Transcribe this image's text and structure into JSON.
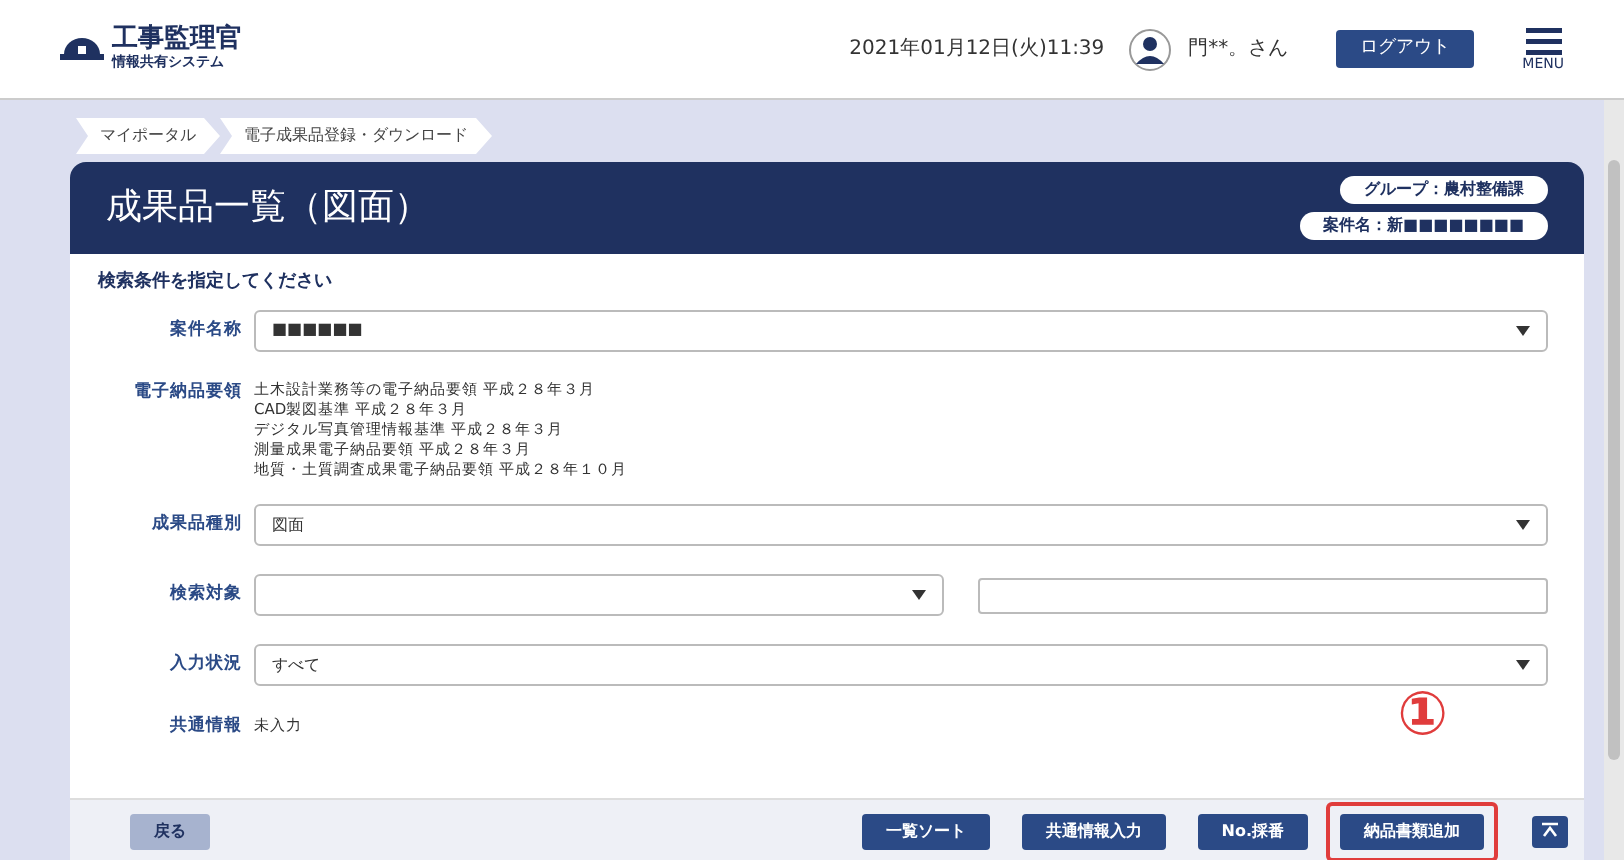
{
  "header": {
    "logo_title": "工事監理官",
    "logo_subtitle": "情報共有システム",
    "datetime": "2021年01月12日(火)11:39",
    "user_name": "門**。さん",
    "logout": "ログアウト",
    "menu_label": "MENU"
  },
  "breadcrumb": [
    {
      "label": "マイポータル"
    },
    {
      "label": "電子成果品登録・ダウンロード"
    }
  ],
  "page_title": "成果品一覧（図面）",
  "tags": [
    "グループ：農村整備課",
    "案件名：新■■■■■■■■"
  ],
  "section_title": "検索条件を指定してください",
  "fields": [
    {
      "kind": "select",
      "label": "案件名称",
      "value": "■■■■■■"
    },
    {
      "kind": "list",
      "label": "電子納品要領",
      "lines": [
        "土木設計業務等の電子納品要領 平成２８年３月",
        "CAD製図基準 平成２８年３月",
        "デジタル写真管理情報基準 平成２８年３月",
        "測量成果電子納品要領 平成２８年３月",
        "地質・土質調査成果電子納品要領 平成２８年１０月"
      ]
    },
    {
      "kind": "select",
      "label": "成果品種別",
      "value": "図面"
    },
    {
      "kind": "select_input",
      "label": "検索対象"
    },
    {
      "kind": "select",
      "label": "入力状況",
      "value": "すべて"
    },
    {
      "kind": "text",
      "label": "共通情報",
      "value": "未入力"
    }
  ],
  "footer": {
    "back": "戻る",
    "buttons": [
      {
        "label": "一覧ソート",
        "highlighted": false
      },
      {
        "label": "共通情報入力",
        "highlighted": false
      },
      {
        "label": "No.採番",
        "highlighted": false
      },
      {
        "label": "納品書類追加",
        "highlighted": true
      }
    ]
  },
  "callout": "①"
}
